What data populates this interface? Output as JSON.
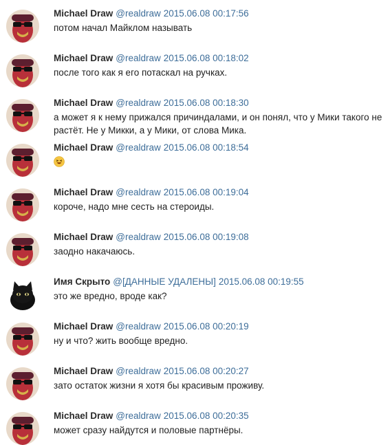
{
  "messages": [
    {
      "author": "Michael Draw",
      "handle": "@realdraw",
      "time": "2015.06.08 00:17:56",
      "text": "потом начал Майклом называть",
      "avatar": "user-avatar"
    },
    {
      "author": "Michael Draw",
      "handle": "@realdraw",
      "time": "2015.06.08 00:18:02",
      "text": "после того как я его потаскал на ручках.",
      "avatar": "user-avatar"
    },
    {
      "author": "Michael Draw",
      "handle": "@realdraw",
      "time": "2015.06.08 00:18:30",
      "text": "а может я к нему прижался причиндалами, и он понял, что у Мики такого не растёт. Не у Микки, а у Мики, от слова Мика.",
      "avatar": "user-avatar"
    },
    {
      "author": "Michael Draw",
      "handle": "@realdraw",
      "time": "2015.06.08 00:18:54",
      "text": "",
      "emoji": "laughing-emoji",
      "avatar": "user-avatar"
    },
    {
      "author": "Michael Draw",
      "handle": "@realdraw",
      "time": "2015.06.08 00:19:04",
      "text": "короче, надо мне сесть на стероиды.",
      "avatar": "user-avatar"
    },
    {
      "author": "Michael Draw",
      "handle": "@realdraw",
      "time": "2015.06.08 00:19:08",
      "text": "заодно накачаюсь.",
      "avatar": "user-avatar"
    },
    {
      "author": "Имя Скрыто",
      "handle": "@[ДАННЫЕ УДАЛЕНЫ]",
      "time": "2015.06.08 00:19:55",
      "text": "это же вредно, вроде как?",
      "avatar": "cat-avatar"
    },
    {
      "author": "Michael Draw",
      "handle": "@realdraw",
      "time": "2015.06.08 00:20:19",
      "text": "ну и что? жить вообще вредно.",
      "avatar": "user-avatar"
    },
    {
      "author": "Michael Draw",
      "handle": "@realdraw",
      "time": "2015.06.08 00:20:27",
      "text": "зато остаток жизни я хотя бы красивым проживу.",
      "avatar": "user-avatar"
    },
    {
      "author": "Michael Draw",
      "handle": "@realdraw",
      "time": "2015.06.08 00:20:35",
      "text": "может сразу найдутся и половые партнёры.",
      "avatar": "user-avatar"
    }
  ]
}
